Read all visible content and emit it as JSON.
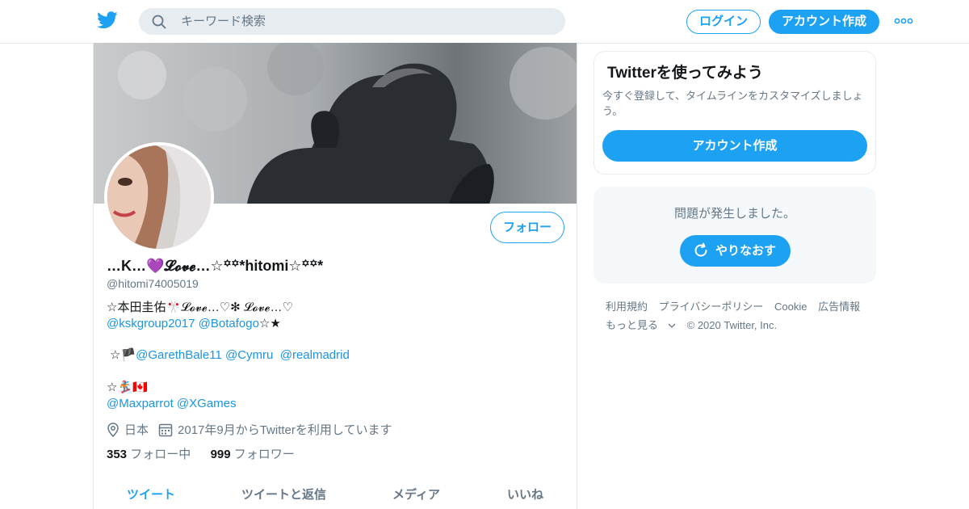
{
  "header": {
    "logo_icon": "twitter-bird-icon",
    "search_placeholder": "キーワード検索",
    "login_label": "ログイン",
    "signup_label": "アカウント作成",
    "more_icon": "more-dots-icon"
  },
  "profile": {
    "display_name": "…K…💜𝓛𝓸𝓿𝓮…☆꙳꙳*hitomi☆꙳꙳*",
    "handle": "@hitomi74005019",
    "follow_label": "フォロー",
    "bio": {
      "line1": "☆本田圭佑🎌𝓛𝓸𝓿𝓮…♡✻ 𝓛𝓸𝓿𝓮…♡",
      "line2_link1": "@kskgroup2017",
      "line2_link2": "@Botafogo",
      "line2_suffix": "☆★",
      "line3_prefix": "☆🏴",
      "line3_link1": "@GarethBale11",
      "line3_link2": "@Cymru",
      "line3_link3": "@realmadrid",
      "line4": "☆🏂🇨🇦",
      "line5_link1": "@Maxparrot",
      "line5_link2": "@XGames"
    },
    "location": "日本",
    "joined": "2017年9月からTwitterを利用しています",
    "following_count": "353",
    "following_label": "フォロー中",
    "followers_count": "999",
    "followers_label": "フォロワー",
    "tabs": [
      "ツイート",
      "ツイートと返信",
      "メディア",
      "いいね"
    ]
  },
  "sidebar": {
    "card_title": "Twitterを使ってみよう",
    "card_desc": "今すぐ登録して、タイムラインをカスタマイズしましょう。",
    "card_button": "アカウント作成",
    "error_msg": "問題が発生しました。",
    "retry_label": "やりなおす"
  },
  "footer": {
    "links": [
      "利用規約",
      "プライバシーポリシー",
      "Cookie",
      "広告情報"
    ],
    "more": "もっと見る",
    "copyright": "© 2020 Twitter, Inc."
  },
  "colors": {
    "accent": "#1da1f2",
    "link": "#1b95e0",
    "muted": "#657786"
  }
}
